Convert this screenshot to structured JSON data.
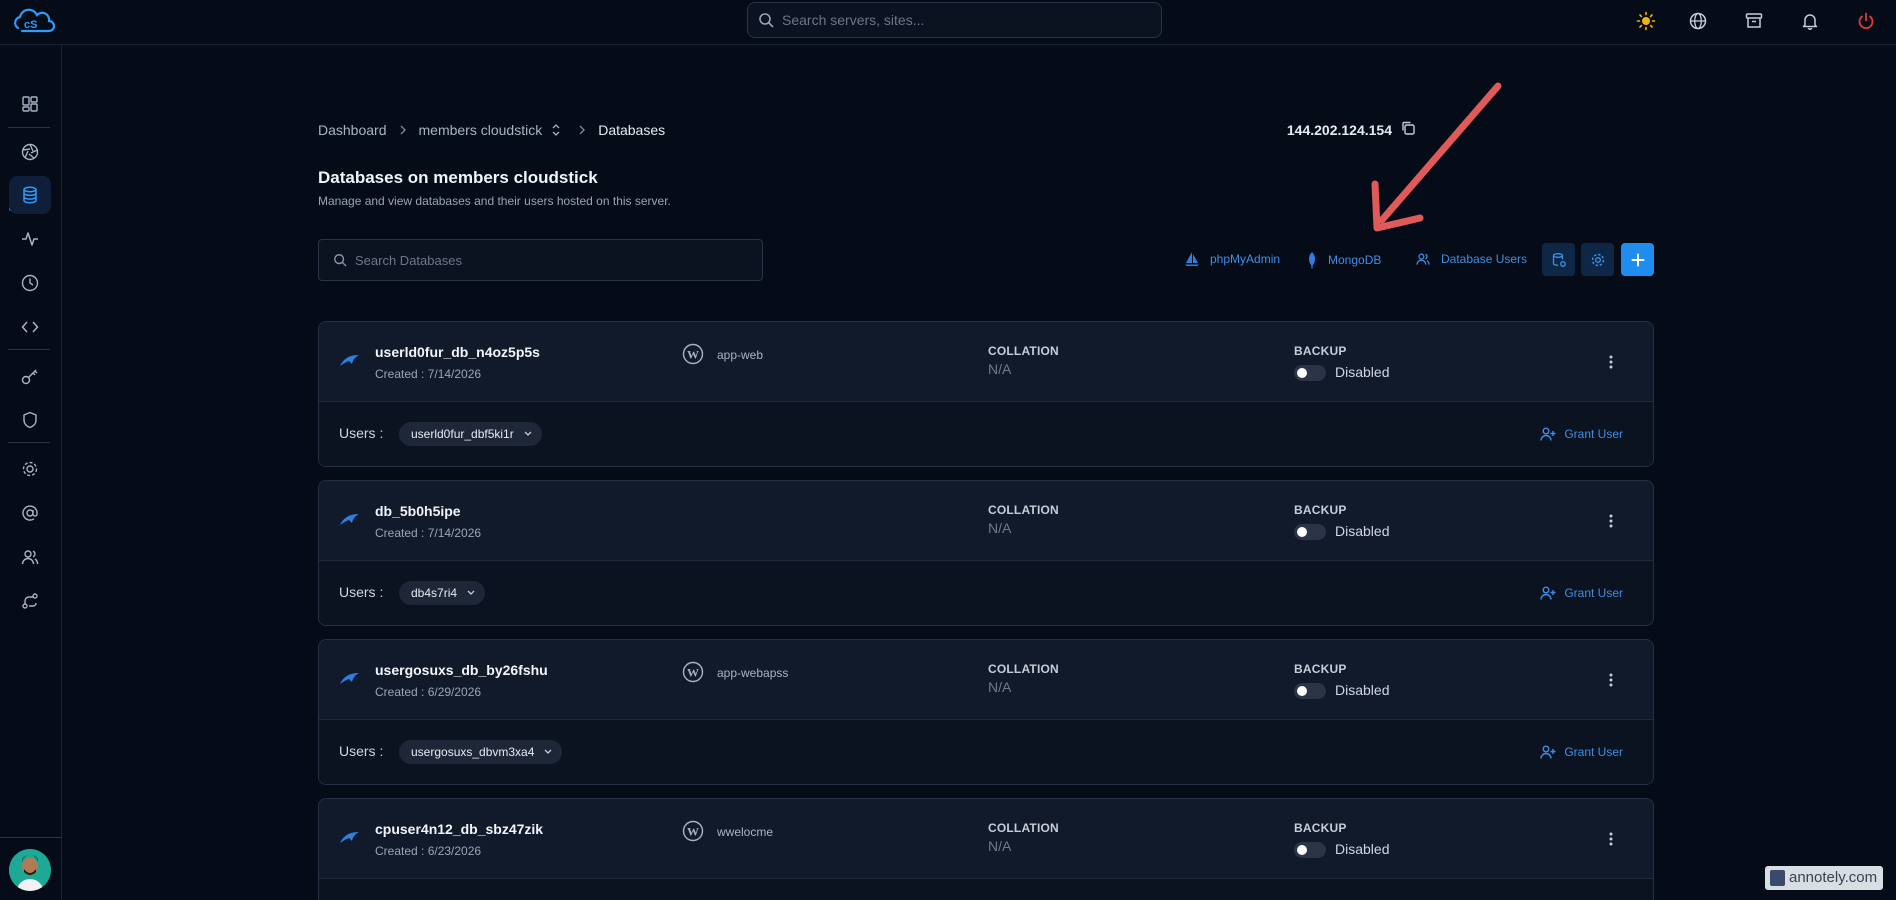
{
  "header": {
    "search_placeholder": "Search servers, sites..."
  },
  "breadcrumb": {
    "dashboard": "Dashboard",
    "server": "members cloudstick",
    "current": "Databases"
  },
  "server_ip": "144.202.124.154",
  "page": {
    "title": "Databases on members cloudstick",
    "subtitle": "Manage and view databases and their users hosted on this server."
  },
  "db_search": {
    "placeholder": "Search Databases"
  },
  "actions": {
    "phpmyadmin": "phpMyAdmin",
    "mongodb": "MongoDB",
    "database_users": "Database Users"
  },
  "labels": {
    "collation": "COLLATION",
    "backup": "BACKUP",
    "users": "Users :",
    "grant_user": "Grant User"
  },
  "databases": [
    {
      "name": "userld0fur_db_n4oz5p5s",
      "created": "Created : 7/14/2026",
      "site": "app-web",
      "collation": "N/A",
      "backup": "Disabled",
      "user": "userld0fur_dbf5ki1r"
    },
    {
      "name": "db_5b0h5ipe",
      "created": "Created : 7/14/2026",
      "site": "",
      "collation": "N/A",
      "backup": "Disabled",
      "user": "db4s7ri4"
    },
    {
      "name": "usergosuxs_db_by26fshu",
      "created": "Created : 6/29/2026",
      "site": "app-webapss",
      "collation": "N/A",
      "backup": "Disabled",
      "user": "usergosuxs_dbvm3xa4"
    },
    {
      "name": "cpuser4n12_db_sbz47zik",
      "created": "Created : 6/23/2026",
      "site": "wwelocme",
      "collation": "N/A",
      "backup": "Disabled",
      "user": ""
    }
  ],
  "watermark": "annotely.com",
  "colors": {
    "background": "#050b17",
    "card": "#111a2b",
    "accent": "#1f8cf0",
    "link": "#3d8fe6",
    "annotation_arrow": "#e05a5a"
  }
}
